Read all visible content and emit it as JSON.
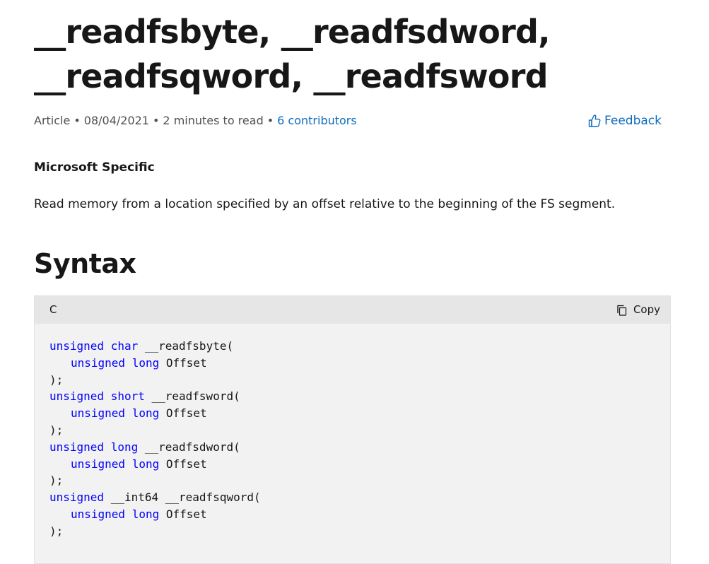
{
  "title": {
    "line1": "__readfsbyte, __readfsdword,",
    "line2": "__readfsqword, __readfsword"
  },
  "meta": {
    "type": "Article",
    "date": "08/04/2021",
    "read_time": "2 minutes to read",
    "contributors": "6 contributors",
    "separator": "•"
  },
  "feedback": {
    "label": "Feedback",
    "icon": "thumbs-up-icon"
  },
  "subheading": "Microsoft Specific",
  "description": "Read memory from a location specified by an offset relative to the beginning of the FS segment.",
  "syntax_heading": "Syntax",
  "code": {
    "language": "C",
    "copy_label": "Copy",
    "copy_icon": "copy-icon",
    "keyword_color": "#0101fd",
    "lines": [
      {
        "kw": "unsigned char",
        "rest": " __readfsbyte("
      },
      {
        "kw": "unsigned long",
        "rest": " Offset",
        "indent": true
      },
      {
        "kw": "",
        "rest": ");"
      },
      {
        "kw": "unsigned short",
        "rest": " __readfsword("
      },
      {
        "kw": "unsigned long",
        "rest": " Offset",
        "indent": true
      },
      {
        "kw": "",
        "rest": ");"
      },
      {
        "kw": "unsigned long",
        "rest": " __readfsdword("
      },
      {
        "kw": "unsigned long",
        "rest": " Offset",
        "indent": true
      },
      {
        "kw": "",
        "rest": ");"
      },
      {
        "kw": "unsigned",
        "rest": " __int64 __readfsqword("
      },
      {
        "kw": "unsigned long",
        "rest": " Offset",
        "indent": true
      },
      {
        "kw": "",
        "rest": ");"
      }
    ]
  },
  "colors": {
    "link": "#0f6cbd",
    "text": "#171717",
    "meta_text": "#505050",
    "code_bg": "#f2f2f2",
    "code_header_bg": "#e6e6e6"
  }
}
